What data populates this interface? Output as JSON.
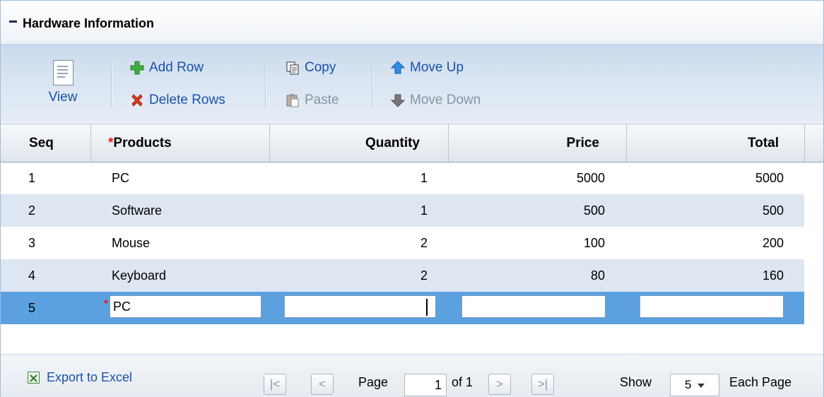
{
  "panel": {
    "title": "Hardware Information"
  },
  "toolbar": {
    "view": "View",
    "add_row": "Add Row",
    "delete_rows": "Delete Rows",
    "copy": "Copy",
    "paste": "Paste",
    "move_up": "Move Up",
    "move_down": "Move Down"
  },
  "grid": {
    "columns": [
      "Seq",
      "Products",
      "Quantity",
      "Price",
      "Total"
    ],
    "required_marker": "*",
    "rows": [
      [
        "1",
        "PC",
        "1",
        "5000",
        "5000"
      ],
      [
        "2",
        "Software",
        "1",
        "500",
        "500"
      ],
      [
        "3",
        "Mouse",
        "2",
        "100",
        "200"
      ],
      [
        "4",
        "Keyboard",
        "2",
        "80",
        "160"
      ]
    ],
    "edit_row": {
      "seq": "5",
      "product": "PC",
      "quantity": "",
      "price": "",
      "total": ""
    }
  },
  "footer": {
    "export": "Export to Excel",
    "page_label": "Page",
    "page_value": "1",
    "of_label": "of 1",
    "show_label": "Show",
    "show_value": "5",
    "each_page_label": "Each Page",
    "first_glyph": "|<",
    "prev_glyph": "<",
    "next_glyph": ">",
    "last_glyph": ">|"
  },
  "colors": {
    "selected_row": "#5ba1e0",
    "alt_row": "#dde6f1",
    "link": "#1a52a6",
    "required": "#e02020"
  }
}
